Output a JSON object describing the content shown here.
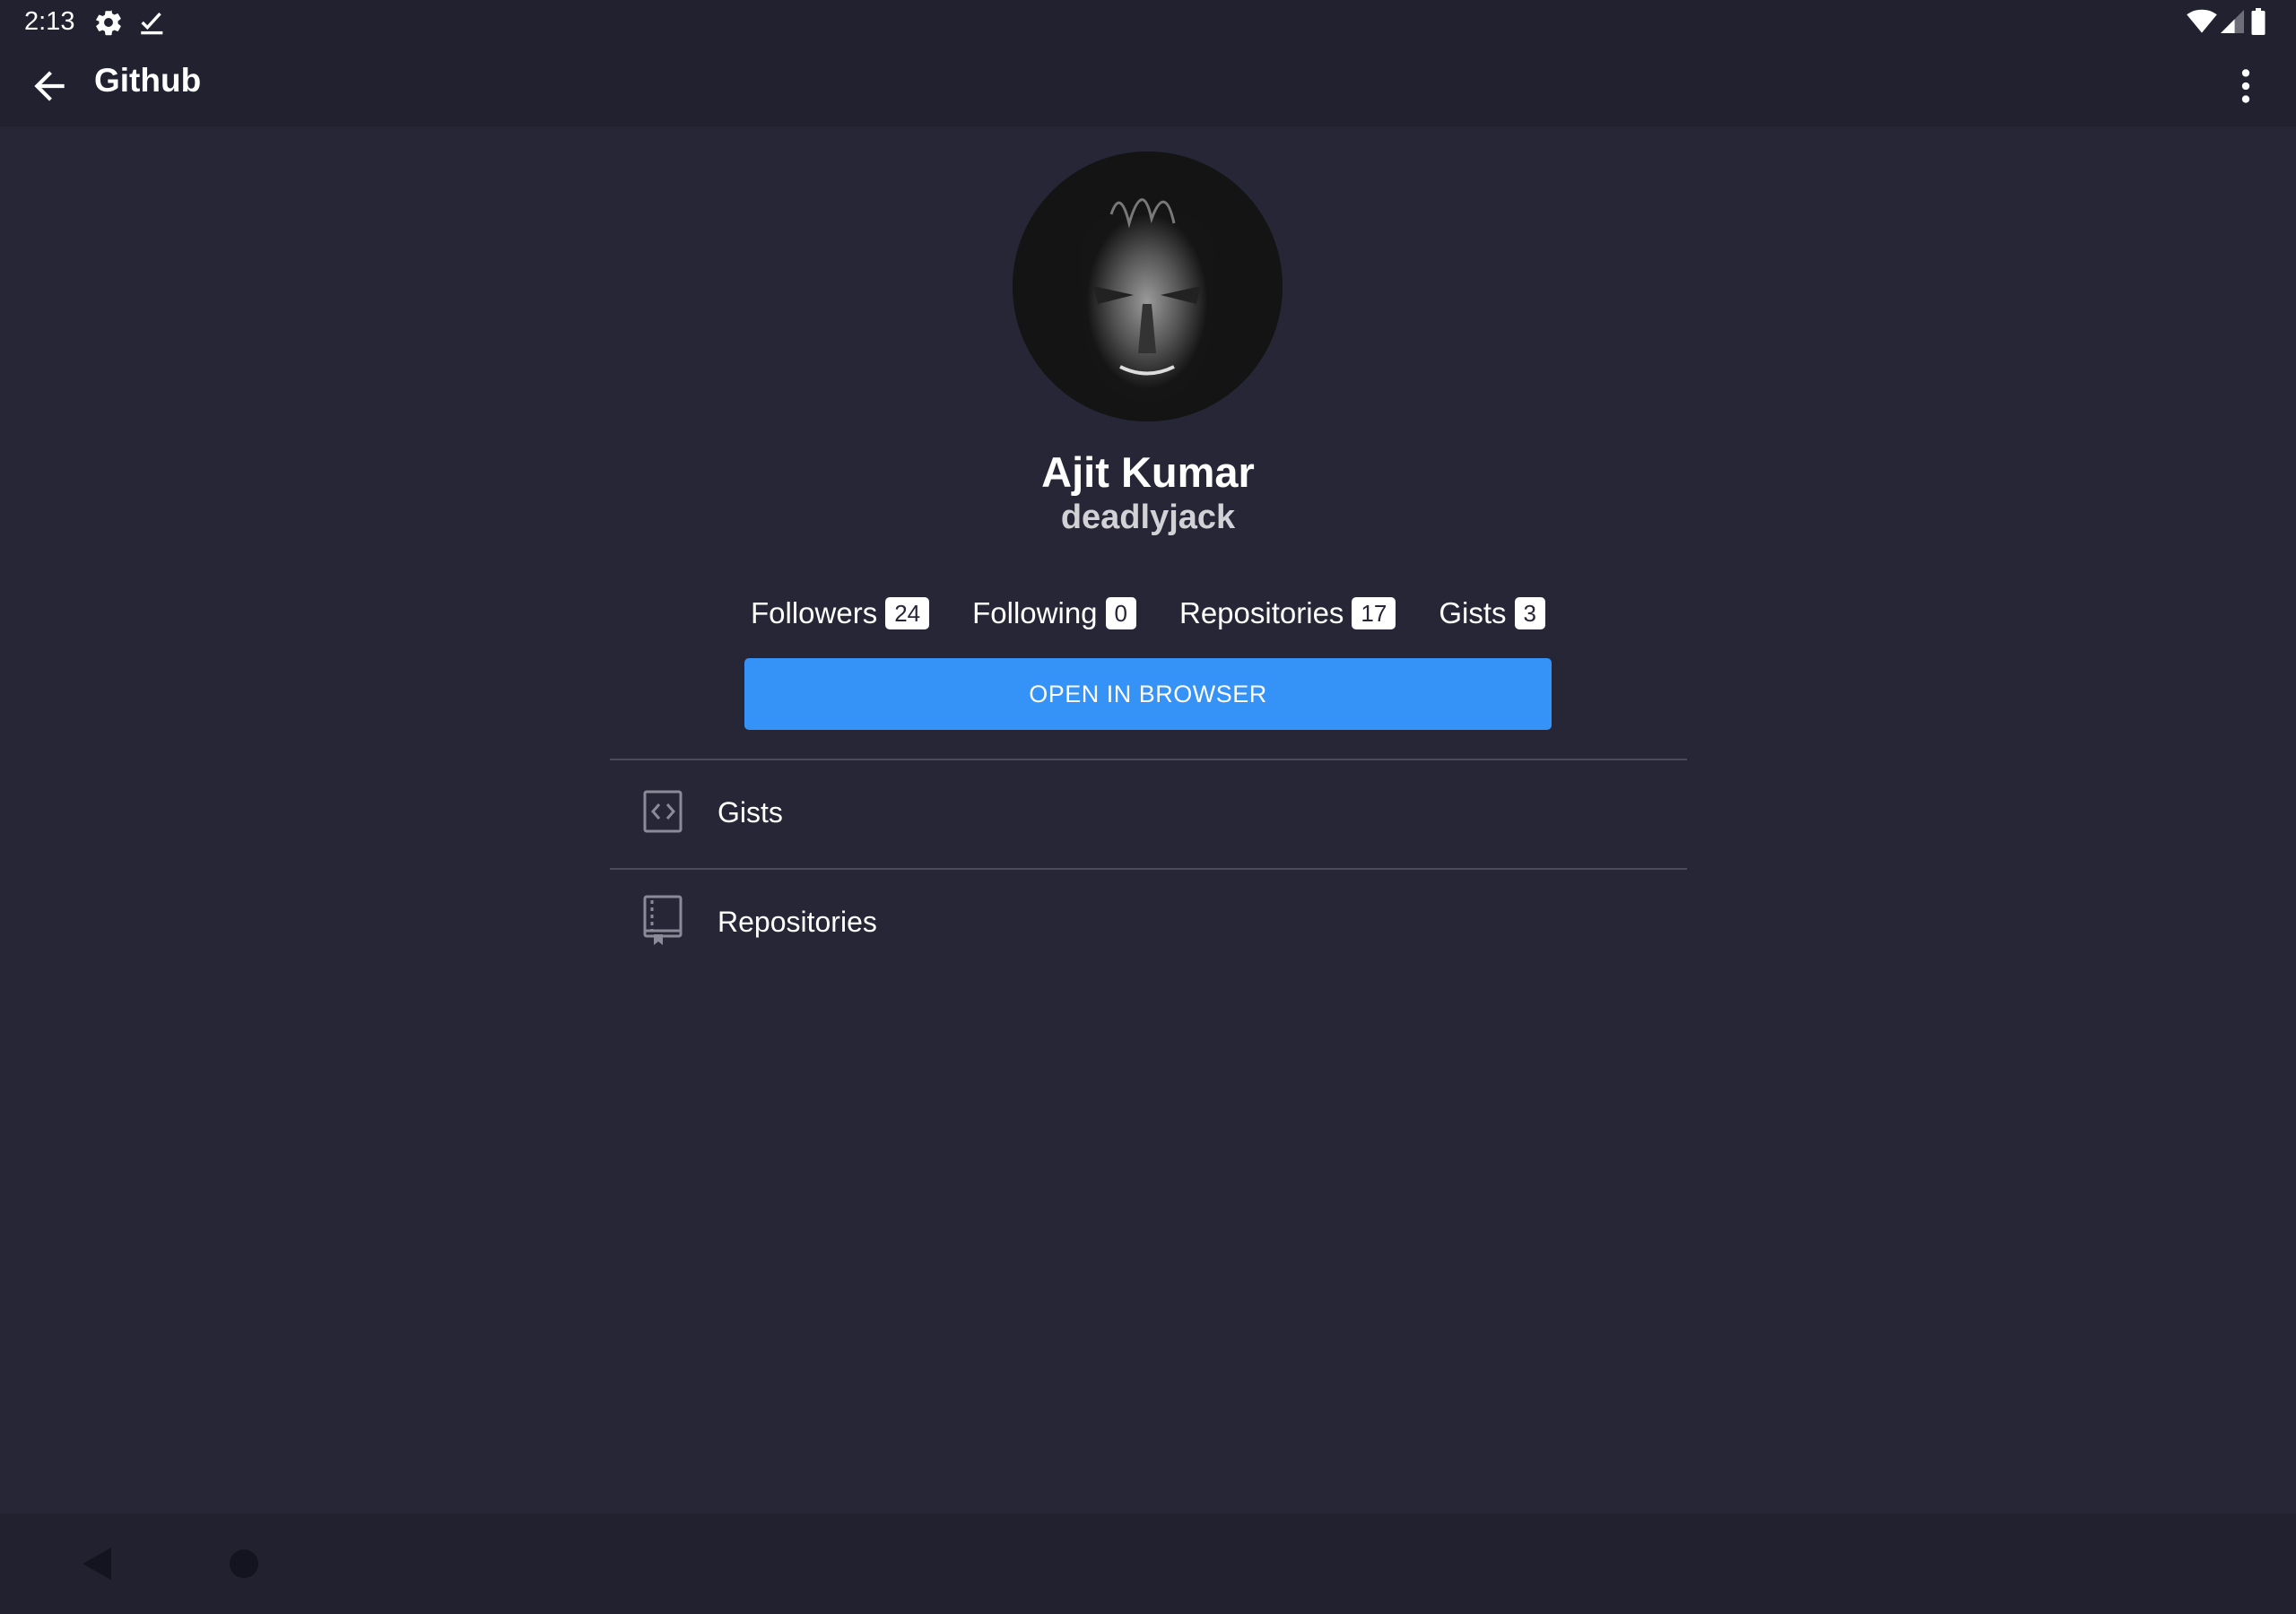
{
  "status_bar": {
    "time": "2:13",
    "left_icons": [
      "settings-icon",
      "checklist-icon"
    ],
    "right_icons": [
      "wifi-icon",
      "signal-icon",
      "battery-icon"
    ]
  },
  "app_bar": {
    "title": "Github",
    "back_icon": "arrow-back-icon",
    "menu_icon": "more-vert-icon"
  },
  "profile": {
    "name": "Ajit Kumar",
    "username": "deadlyjack"
  },
  "stats": [
    {
      "label": "Followers",
      "count": "24"
    },
    {
      "label": "Following",
      "count": "0"
    },
    {
      "label": "Repositories",
      "count": "17"
    },
    {
      "label": "Gists",
      "count": "3"
    }
  ],
  "open_button": "OPEN IN BROWSER",
  "list": [
    {
      "label": "Gists",
      "icon": "code-icon"
    },
    {
      "label": "Repositories",
      "icon": "repo-icon"
    }
  ],
  "colors": {
    "background": "#262636",
    "bar": "#212130",
    "accent": "#3592f7"
  }
}
